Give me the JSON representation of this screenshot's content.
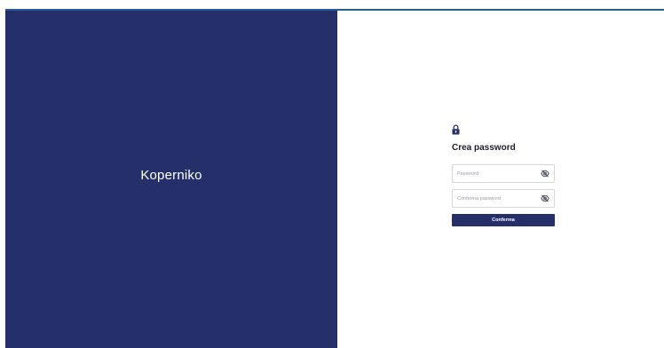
{
  "brand": {
    "name": "Koperniko"
  },
  "form": {
    "icon": "lock-icon",
    "title": "Crea password",
    "password": {
      "placeholder": "Password",
      "value": "",
      "toggle_icon": "eye-off-icon"
    },
    "confirm_password": {
      "placeholder": "Conferma password",
      "value": "",
      "toggle_icon": "eye-off-icon"
    },
    "submit_label": "Conferma"
  },
  "colors": {
    "brand_panel": "#25306a",
    "accent_line": "#2c5a9a",
    "button": "#25306a"
  }
}
